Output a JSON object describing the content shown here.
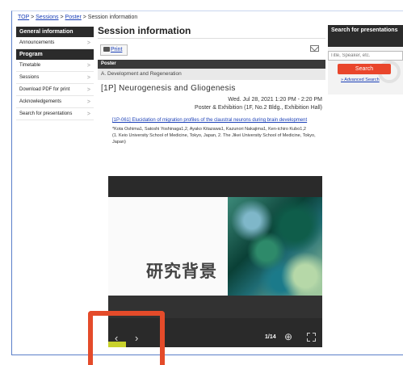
{
  "breadcrumb": {
    "top": "TOP",
    "sep": ">",
    "sessions": "Sessions",
    "poster": "Poster",
    "current": "Session information"
  },
  "sidebar": {
    "general_heading": "General information",
    "general_items": [
      {
        "label": "Announcements"
      }
    ],
    "program_heading": "Program",
    "program_items": [
      {
        "label": "Timetable"
      },
      {
        "label": "Sessions"
      },
      {
        "label": "Download PDF for print"
      },
      {
        "label": "Acknowledgements"
      },
      {
        "label": "Search for presentations"
      }
    ],
    "chevron": ">"
  },
  "main": {
    "title": "Session information",
    "print_label": "Print",
    "section_label": "Poster",
    "subsection": "A. Development and Regeneration",
    "session_title": "[1P] Neurogenesis and Gliogenesis",
    "session_time": "Wed. Jul 28, 2021 1:20 PM - 2:20 PM",
    "session_venue": "Poster & Exhibition (1F, No.2 Bldg., Exhibition Hall)",
    "abstract_title": "[1P-061] Elucidation of migration profiles of the claustral neurons during brain development",
    "authors": "*Kota Oshima1, Satoshi Yoshinaga1,2, Ayako Kitazawa1, Kazunori Nakajima1, Ken-ichiro Kubo1,2",
    "affiliations": "(1. Keio University School of Medicine, Tokyo, Japan, 2. The Jikei University School of Medicine, Tokyo, Japan)"
  },
  "viewer": {
    "slide_heading": "研究背景",
    "prev": "‹",
    "next": "›",
    "page_count": "1/14",
    "zoom": "⊕"
  },
  "search": {
    "heading": "Search for presentations",
    "placeholder": "Title, Speaker, etc.",
    "button": "Search",
    "advanced": "» Advanced Search"
  },
  "colors": {
    "accent_red": "#e9462c",
    "highlight": "#e44b2a",
    "link_blue": "#1a3fb7",
    "dark_header": "#2b2b2b"
  }
}
